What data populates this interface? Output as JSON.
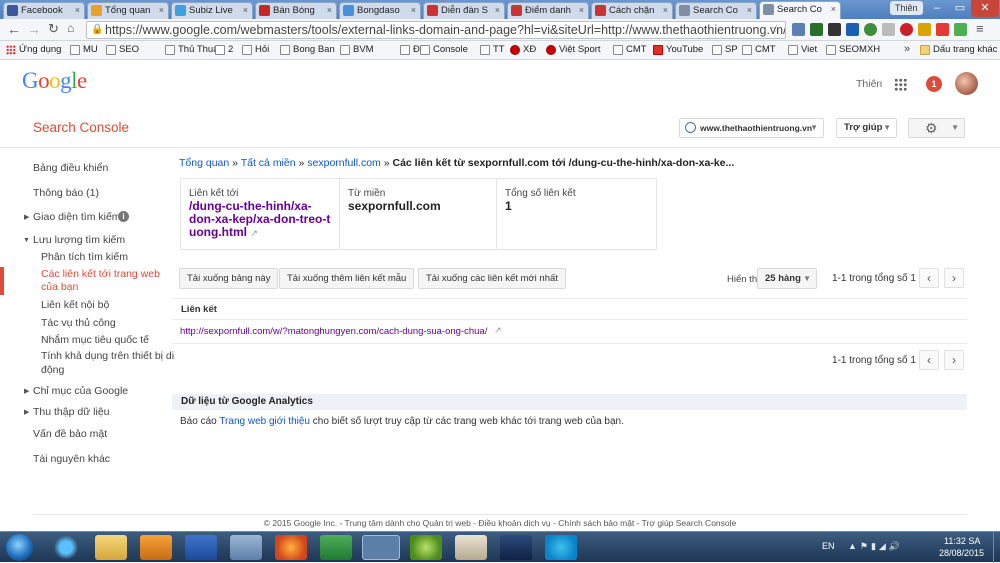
{
  "browser": {
    "tabs": [
      {
        "label": "Facebook",
        "color": "#3b5998"
      },
      {
        "label": "Tổng quan",
        "color": "#e8a030"
      },
      {
        "label": "Subiz Live",
        "color": "#3fa0e0"
      },
      {
        "label": "Bán Bóng",
        "color": "#c62828"
      },
      {
        "label": "Bongdaso",
        "color": "#4a90d9"
      },
      {
        "label": "Diễn đàn S",
        "color": "#c33"
      },
      {
        "label": "Điểm danh",
        "color": "#c33"
      },
      {
        "label": "Cách chặn",
        "color": "#c33"
      },
      {
        "label": "Search Co",
        "color": "#7f8fa6"
      },
      {
        "label": "Search Co",
        "color": "#7f8fa6"
      }
    ],
    "user_badge": "Thiên",
    "url": "https://www.google.com/webmasters/tools/external-links-domain-and-page?hl=vi&siteUrl=http://www.thethaothientruong.vn/",
    "bookmarks": [
      "Ứng dụng",
      "MU",
      "SEO",
      "Thủ Thuật",
      "2",
      "Hỏi",
      "Bong Ban",
      "BVM",
      "ĐC",
      "Console",
      "TT",
      "XĐ",
      "Việt Sport",
      "CMT",
      "YouTube",
      "SP",
      "CMT",
      "Viet",
      "SEOMXH"
    ],
    "bookmarks_more": "»",
    "bookmarks_other": "Dấu trang khác"
  },
  "google": {
    "logo": "Google",
    "user_name": "Thiên",
    "notification_count": "1"
  },
  "console": {
    "title": "Search Console",
    "site": "www.thethaothientruong.vn",
    "help": "Trợ giúp"
  },
  "sidebar": {
    "dashboard": "Bảng điều khiển",
    "messages": "Thông báo (1)",
    "search_appearance": "Giao diện tìm kiếm",
    "search_traffic": "Lưu lượng tìm kiếm",
    "sub": {
      "analytics": "Phân tích tìm kiếm",
      "links_line1": "Các liên kết tới trang web",
      "links_line2": "của bạn",
      "internal": "Liên kết nội bộ",
      "manual": "Tác vụ thủ công",
      "intl": "Nhắm mục tiêu quốc tế",
      "mobile_line1": "Tính khả dụng trên thiết bị di",
      "mobile_line2": "động"
    },
    "index": "Chỉ mục của Google",
    "crawl": "Thu thập dữ liệu",
    "security": "Vấn đề bảo mật",
    "other": "Tài nguyên khác"
  },
  "breadcrumb": {
    "overview": "Tổng quan",
    "all_domains": "Tất cả miền",
    "domain": "sexpornfull.com",
    "sep": "»",
    "current": "Các liên kết từ sexpornfull.com tới /dung-cu-the-hinh/xa-don-xa-ke..."
  },
  "summary": {
    "target_label": "Liên kết tới",
    "target_line1": "/dung-cu-the-hinh/xa-",
    "target_line2": "don-xa-kep/xa-don-treo-t",
    "target_line3": "uong.html",
    "domain_label": "Từ miền",
    "domain_value": "sexpornfull.com",
    "total_label": "Tổng số liên kết",
    "total_value": "1"
  },
  "actions": {
    "download_table": "Tải xuống bảng này",
    "download_more": "Tải xuống thêm liên kết mẫu",
    "download_latest": "Tải xuống các liên kết mới nhất",
    "show_label": "Hiển thị",
    "rows": "25 hàng",
    "range": "1-1 trong tổng số 1"
  },
  "table": {
    "header": "Liên kết",
    "rows": [
      "http://sexpornfull.com/w/?matonghungyen.com/cach-dung-sua-ong-chua/"
    ]
  },
  "analytics": {
    "heading": "Dữ liệu từ Google Analytics",
    "text_before": "Báo cáo",
    "link": "Trang web giới thiệu",
    "text_after": "cho biết số lượt truy cập từ các trang web khác tới trang web của bạn."
  },
  "footer": "© 2015 Google Inc. - Trung tâm dành cho Quản trị web - Điều khoản dịch vụ - Chính sách bảo mật - Trợ giúp Search Console",
  "taskbar": {
    "lang": "EN",
    "time": "11:32 SA",
    "date": "28/08/2015"
  },
  "colors": {
    "accent_red": "#dd4b39",
    "link_blue": "#1155cc",
    "purple": "#660099"
  }
}
